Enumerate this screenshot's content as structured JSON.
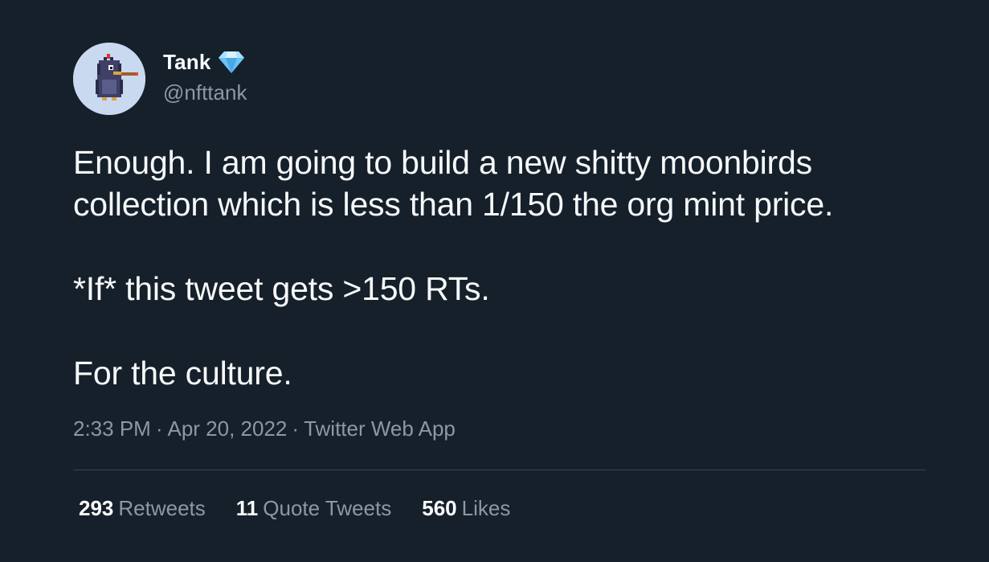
{
  "author": {
    "display_name": "Tank",
    "handle": "@nfttank",
    "badge_icon": "diamond-icon",
    "avatar_icon": "pixel-bird-avatar"
  },
  "tweet": {
    "paragraphs": [
      "Enough. I am going to build a new shitty moonbirds collection which is less than 1/150 the org mint price.",
      "*If* this tweet gets >150 RTs.",
      "For the culture."
    ]
  },
  "meta": {
    "time": "2:33 PM",
    "separator": "·",
    "date": "Apr 20, 2022",
    "source": "Twitter Web App"
  },
  "stats": {
    "retweets_count": "293",
    "retweets_label": "Retweets",
    "quote_tweets_count": "11",
    "quote_tweets_label": "Quote Tweets",
    "likes_count": "560",
    "likes_label": "Likes"
  },
  "colors": {
    "background": "#15202b",
    "text": "#f7f9f9",
    "muted": "#8b98a5",
    "divider": "#38444d",
    "gem": "#69c3f5"
  }
}
